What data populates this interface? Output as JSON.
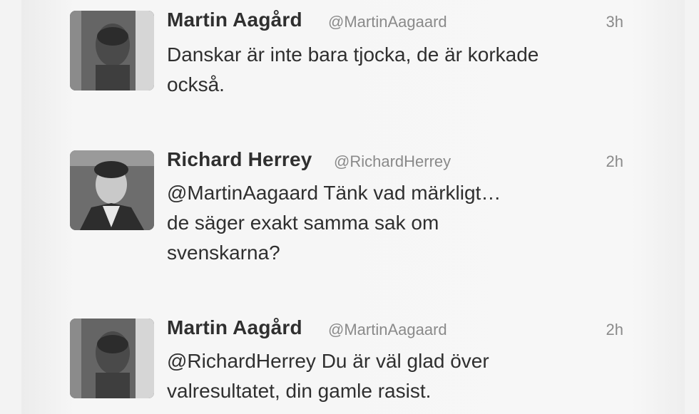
{
  "tweets": [
    {
      "name": "Martin Aagård",
      "handle": "@MartinAagaard",
      "time": "3h",
      "lines": [
        "Danskar är inte bara tjocka, de är korkade",
        "också."
      ],
      "avatar": "profile-photo-icon"
    },
    {
      "name": "Richard Herrey",
      "handle": "@RichardHerrey",
      "time": "2h",
      "lines": [
        "@MartinAagaard Tänk vad märkligt…",
        "de säger exakt samma sak om",
        "svenskarna?"
      ],
      "avatar": "profile-photo-icon"
    },
    {
      "name": "Martin Aagård",
      "handle": "@MartinAagaard",
      "time": "2h",
      "lines": [
        "@RichardHerrey Du är väl glad över",
        "valresultatet, din gamle rasist."
      ],
      "avatar": "profile-photo-icon"
    }
  ]
}
